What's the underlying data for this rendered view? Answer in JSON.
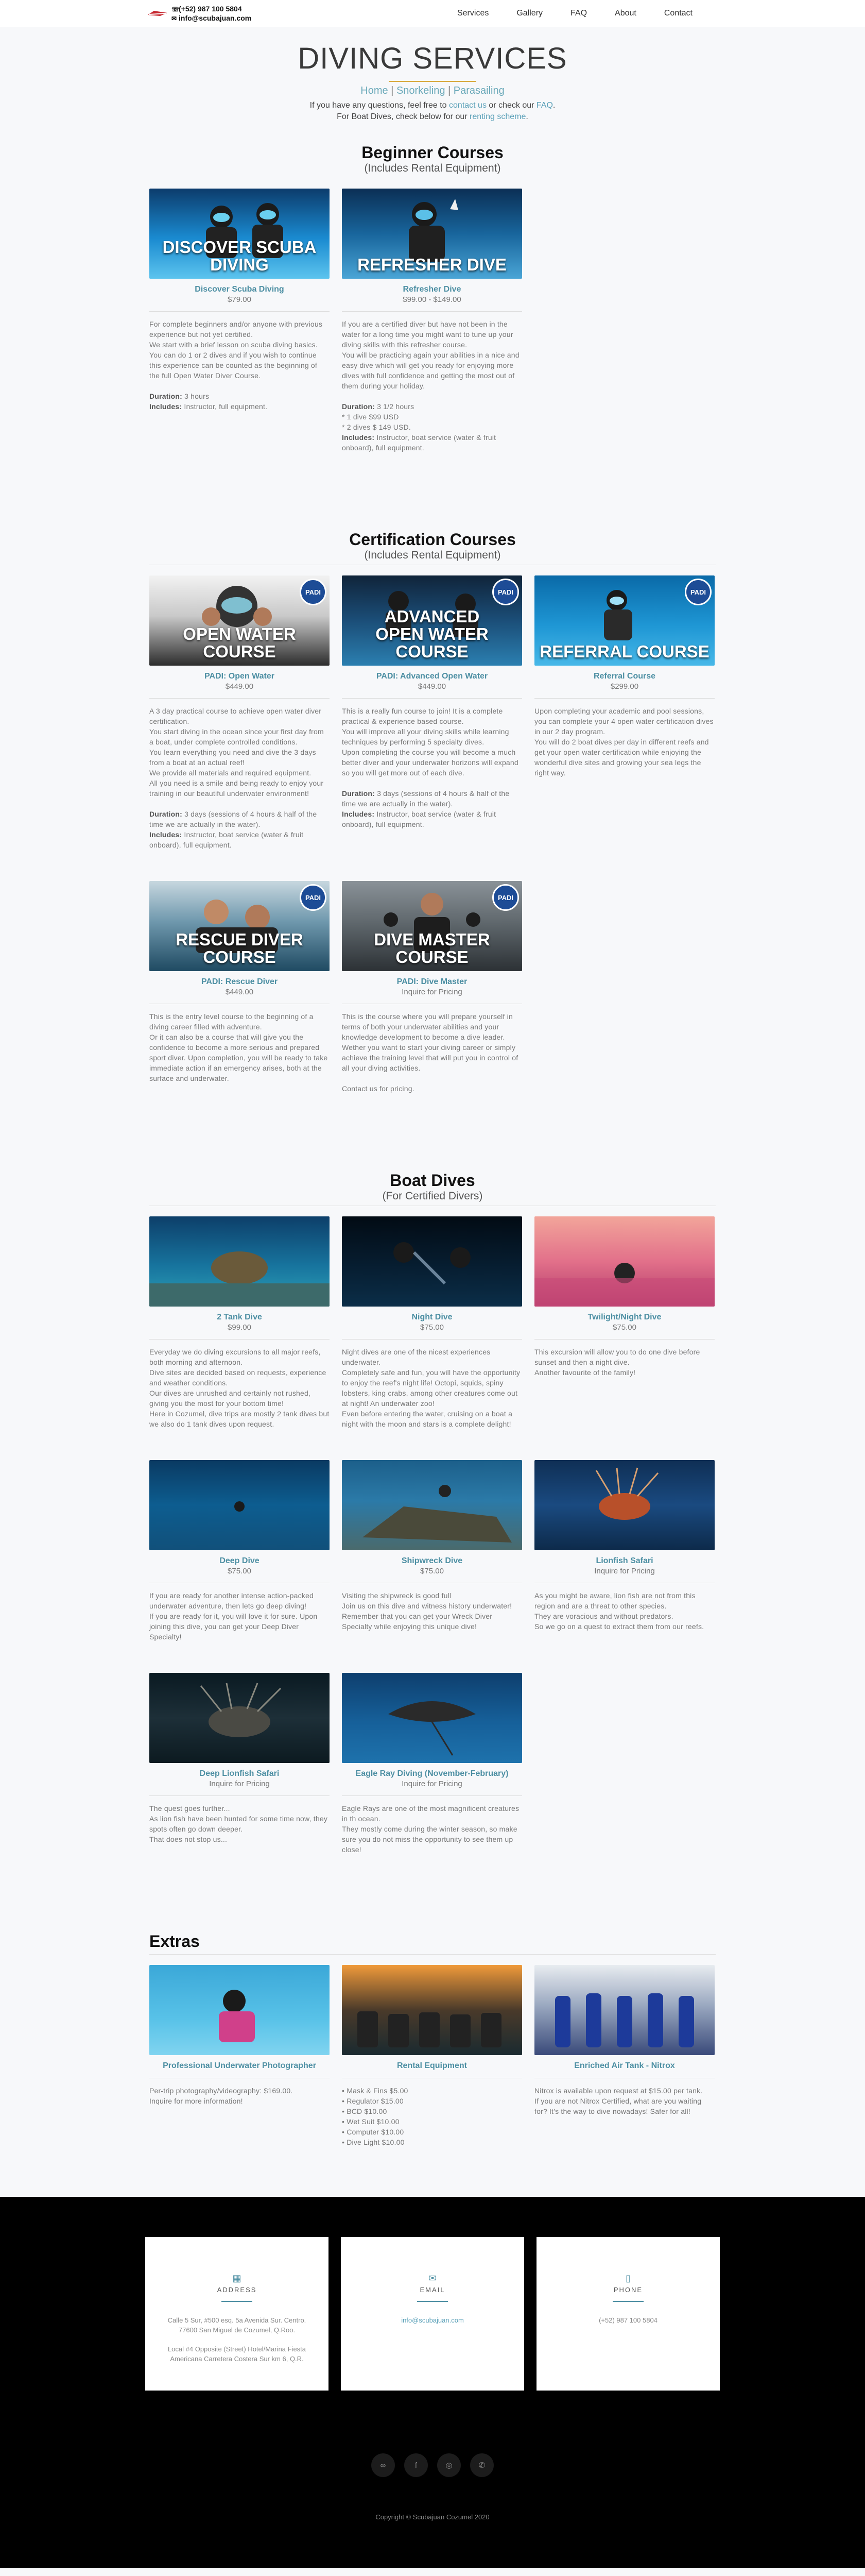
{
  "header": {
    "phone": "(+52) 987 100 5804",
    "email": "info@scubajuan.com",
    "nav": [
      "Services",
      "Gallery",
      "FAQ",
      "About",
      "Contact"
    ]
  },
  "hero": {
    "title": "DIVING SERVICES",
    "subnav": [
      "Home",
      "Snorkeling",
      "Parasailing"
    ],
    "line1_a": "If you have any questions, feel free to ",
    "line1_link1": "contact us",
    "line1_b": " or check our ",
    "line1_link2": "FAQ",
    "line1_c": ".",
    "line2_a": "For Boat Dives, check below for our ",
    "line2_link": "renting scheme",
    "line2_b": "."
  },
  "beginner": {
    "title": "Beginner Courses",
    "subtitle": "(Includes Rental Equipment)",
    "cards": [
      {
        "caption": "DISCOVER SCUBA DIVING",
        "name": "Discover Scuba Diving",
        "price": "$79.00",
        "desc": [
          "For complete beginners and/or anyone with previous experience but not yet certified.",
          "We start with a brief lesson on scuba diving basics.",
          "You can do 1 or 2 dives and if you wish to continue this experience can be counted as the beginning of the full Open Water Diver Course."
        ],
        "duration_label": "Duration:",
        "duration": "3 hours",
        "includes_label": "Includes:",
        "includes": "Instructor, full equipment."
      },
      {
        "caption": "REFRESHER DIVE",
        "name": "Refresher Dive",
        "price": "$99.00 - $149.00",
        "desc": [
          "If you are a certified diver but have not been in the water for a long time you might want to tune up your diving skills with this refresher course.",
          "You will be practicing again your abilities in a nice and easy dive which will get you ready for enjoying more dives with full confidence and getting the most out of them during your holiday."
        ],
        "duration_label": "Duration:",
        "duration": "3 1/2 hours",
        "extra": [
          "* 1 dive $99 USD",
          "* 2 dives $ 149 USD."
        ],
        "includes_label": "Includes:",
        "includes": "Instructor, boat service (water & fruit onboard), full equipment."
      }
    ]
  },
  "certification": {
    "title": "Certification Courses",
    "subtitle": "(Includes Rental Equipment)",
    "cards": [
      {
        "caption": "OPEN WATER COURSE",
        "name": "PADI: Open Water",
        "price": "$449.00",
        "padi": "PADI",
        "desc": [
          "A 3 day practical course to achieve open water diver certification.",
          "You start diving in the ocean since your first day from a boat, under complete controlled conditions.",
          "You learn everything you need and dive the 3 days from a boat at an actual reef!",
          "We provide all materials and required equipment.",
          "All you need is a smile and being ready to enjoy your training in our beautiful underwater environment!"
        ],
        "duration_label": "Duration:",
        "duration": "3 days (sessions of 4 hours & half of the time we are actually in the water).",
        "includes_label": "Includes:",
        "includes": "Instructor, boat service (water & fruit onboard), full equipment."
      },
      {
        "caption": "ADVANCED OPEN WATER COURSE",
        "caption_l1": "ADVANCED",
        "caption_l2": "OPEN WATER COURSE",
        "name": "PADI: Advanced Open Water",
        "price": "$449.00",
        "padi": "PADI",
        "desc": [
          "This is a really fun course to join! It is a complete practical & experience based course.",
          "You will improve all your diving skills while learning techniques by performing 5 specialty dives.",
          "Upon completing the course you will become a much better diver and your underwater horizons will expand so you will get more out of each dive."
        ],
        "duration_label": "Duration:",
        "duration": "3 days (sessions of 4 hours & half of the time we are actually in the water).",
        "includes_label": "Includes:",
        "includes": "Instructor, boat service (water & fruit onboard), full equipment."
      },
      {
        "caption": "REFERRAL COURSE",
        "name": "Referral Course",
        "price": "$299.00",
        "padi": "PADI",
        "desc": [
          "Upon completing your academic and pool sessions, you can complete your 4 open water certification dives in our 2 day program.",
          "You will do 2 boat dives per day in different reefs and get your open water certification while enjoying the wonderful dive sites and growing your sea legs the right way."
        ]
      }
    ],
    "cards2": [
      {
        "caption": "RESCUE DIVER COURSE",
        "name": "PADI: Rescue Diver",
        "price": "$449.00",
        "padi": "PADI",
        "desc": [
          "This is the entry level course to the beginning of a diving career filled with adventure.",
          "Or it can also be a course that will give you the confidence to become a more serious and prepared sport diver. Upon completion, you will be ready to take immediate action if an emergency arises, both at the surface and underwater."
        ]
      },
      {
        "caption": "DIVE MASTER COURSE",
        "name": "PADI: Dive Master",
        "price": "Inquire for Pricing",
        "padi": "PADI",
        "desc": [
          "This is the course where you will prepare yourself in terms of both your underwater abilities and your knowledge development to become a dive leader.",
          "Wether you want to start your diving career or simply achieve the training level that will put you in control of all your diving activities."
        ],
        "contact": "Contact us for pricing."
      }
    ]
  },
  "boat": {
    "title": "Boat Dives",
    "subtitle": "(For Certified Divers)",
    "row1": [
      {
        "name": "2 Tank Dive",
        "price": "$99.00",
        "desc": [
          "Everyday we do diving excursions to all major reefs, both morning and afternoon.",
          "Dive sites are decided based on requests, experience and weather conditions.",
          "Our dives are unrushed and certainly not rushed, giving you the most for your bottom time!",
          "Here in Cozumel, dive trips are mostly 2 tank dives but we also do 1 tank dives upon request."
        ]
      },
      {
        "name": "Night Dive",
        "price": "$75.00",
        "desc": [
          "Night dives are one of the nicest experiences underwater.",
          "Completely safe and fun, you will have the opportunity to enjoy the reef's night life! Octopi, squids, spiny lobsters, king crabs, among other creatures come out at night! An underwater zoo!",
          "Even before entering the water, cruising on a boat a night with the moon and stars is a complete delight!"
        ]
      },
      {
        "name": "Twilight/Night Dive",
        "price": "$75.00",
        "desc": [
          "This excursion will allow you to do one dive before sunset and then a night dive.",
          "Another favourite of the family!"
        ]
      }
    ],
    "row2": [
      {
        "name": "Deep Dive",
        "price": "$75.00",
        "desc": [
          "If you are ready for another intense action-packed underwater adventure, then lets go deep diving!",
          "If you are ready for it, you will love it for sure. Upon joining this dive, you can get your Deep Diver Specialty!"
        ]
      },
      {
        "name": "Shipwreck Dive",
        "price": "$75.00",
        "desc": [
          "Visiting the shipwreck is good full",
          "Join us on this dive and witness history underwater!",
          "Remember that you can get your Wreck Diver Specialty while enjoying this unique dive!"
        ]
      },
      {
        "name": "Lionfish Safari",
        "price": "Inquire for Pricing",
        "desc": [
          "As you might be aware, lion fish are not from this region and are a threat to other species.",
          "They are voracious and without predators.",
          "So we go on a quest to extract them from our reefs."
        ]
      }
    ],
    "row3": [
      {
        "name": "Deep Lionfish Safari",
        "price": "Inquire for Pricing",
        "desc": [
          "The quest goes further...",
          "As lion fish have been hunted for some time now, they spots often go down deeper.",
          "That does not stop us..."
        ]
      },
      {
        "name": "Eagle Ray Diving (November-February)",
        "price": "Inquire for Pricing",
        "desc": [
          "Eagle Rays are one of the most magnificent creatures in th ocean.",
          "They mostly come during the winter season, so make sure you do not miss the opportunity to see them up close!"
        ]
      }
    ]
  },
  "extras": {
    "title": "Extras",
    "cards": [
      {
        "name": "Professional Underwater Photographer",
        "desc": [
          "Per-trip photography/videography: $169.00.",
          "Inquire for more information!"
        ]
      },
      {
        "name": "Rental Equipment",
        "list": [
          "Mask & Fins $5.00",
          "Regulator $15.00",
          "BCD $10.00",
          "Wet Suit $10.00",
          "Computer $10.00",
          "Dive Light $10.00"
        ]
      },
      {
        "name": "Enriched Air Tank - Nitrox",
        "desc": [
          "Nitrox is available upon request at $15.00 per tank.",
          "If you are not Nitrox Certified, what are you waiting for? It's the way to dive nowadays! Safer for all!"
        ]
      }
    ]
  },
  "footer": {
    "address_label": "ADDRESS",
    "address1": "Calle 5 Sur, #500 esq. 5a Avenida Sur. Centro. 77600 San Miguel de Cozumel, Q.Roo.",
    "address2": "Local #4 Opposite (Street) Hotel/Marina Fiesta Americana Carretera Costera Sur km 6, Q.R.",
    "email_label": "EMAIL",
    "email": "info@scubajuan.com",
    "phone_label": "PHONE",
    "phone": "(+52) 987 100 5804",
    "socials": [
      "tripadvisor-icon",
      "facebook-icon",
      "instagram-icon",
      "whatsapp-icon"
    ],
    "copyright": "Copyright © Scubajuan Cozumel 2020"
  }
}
